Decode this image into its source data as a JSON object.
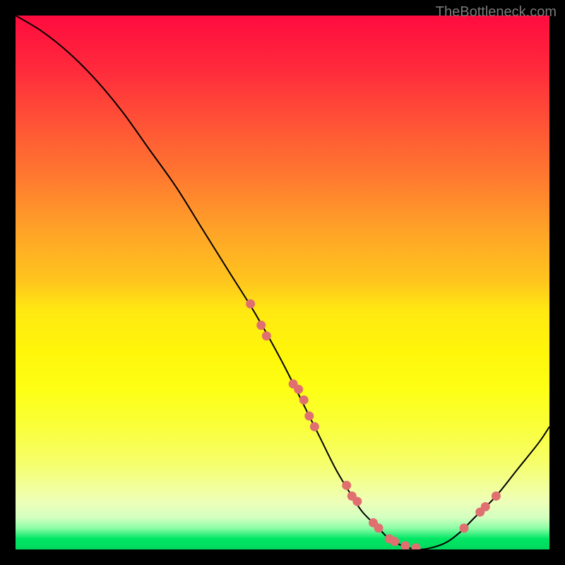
{
  "watermark": "TheBottleneck.com",
  "chart_data": {
    "type": "line",
    "title": "",
    "xlabel": "",
    "ylabel": "",
    "xlim": [
      0,
      100
    ],
    "ylim": [
      0,
      100
    ],
    "curve": {
      "x": [
        0,
        5,
        10,
        15,
        20,
        25,
        30,
        35,
        40,
        45,
        50,
        55,
        57,
        60,
        63,
        65,
        68,
        70,
        73,
        76,
        80,
        83,
        86,
        90,
        94,
        98,
        100
      ],
      "y": [
        100,
        97,
        93,
        88,
        82,
        75,
        68,
        60,
        52,
        44,
        35,
        25,
        21,
        15,
        10,
        7,
        4,
        2,
        0.5,
        0,
        1,
        3,
        6,
        10,
        15,
        20,
        23
      ]
    },
    "markers": {
      "x": [
        44,
        46,
        47,
        52,
        53,
        54,
        55,
        56,
        62,
        63,
        64,
        67,
        68,
        70,
        71,
        73,
        75,
        84,
        87,
        88,
        90
      ],
      "y": [
        46,
        42,
        40,
        31,
        30,
        28,
        25,
        23,
        12,
        10,
        9,
        5,
        4,
        2,
        1.5,
        0.7,
        0.3,
        4,
        7,
        8,
        10
      ]
    }
  }
}
